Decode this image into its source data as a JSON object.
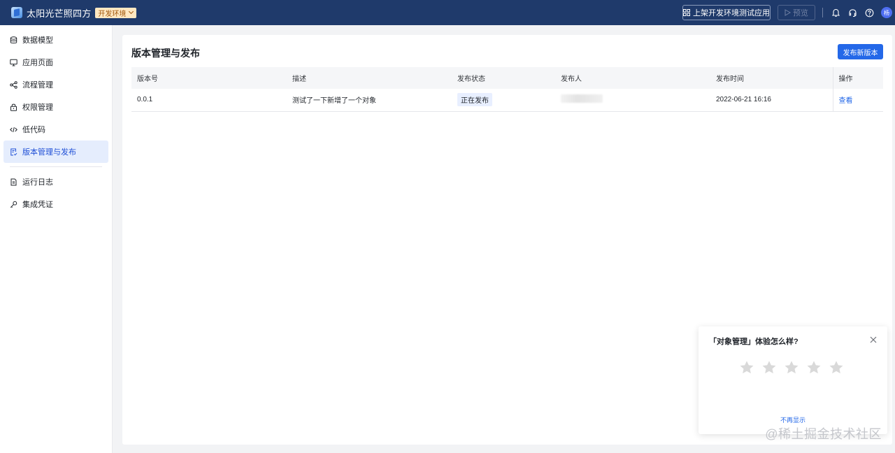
{
  "header": {
    "app_title": "太阳光芒照四方",
    "env_label": "开发环境",
    "publish_test_label": "上架开发环境测试应用",
    "preview_label": "预览",
    "avatar_text": "杨",
    "bg_color": "#1f3a6b"
  },
  "sidebar": {
    "items": [
      {
        "label": "数据模型",
        "icon": "database-icon"
      },
      {
        "label": "应用页面",
        "icon": "monitor-icon"
      },
      {
        "label": "流程管理",
        "icon": "flow-icon"
      },
      {
        "label": "权限管理",
        "icon": "lock-icon"
      },
      {
        "label": "低代码",
        "icon": "code-icon"
      },
      {
        "label": "版本管理与发布",
        "icon": "version-icon",
        "active": true
      }
    ],
    "bottom_items": [
      {
        "label": "运行日志",
        "icon": "document-icon"
      },
      {
        "label": "集成凭证",
        "icon": "key-icon"
      }
    ]
  },
  "main": {
    "title": "版本管理与发布",
    "new_version_button": "发布新版本",
    "table": {
      "columns": [
        "版本号",
        "描述",
        "发布状态",
        "发布人",
        "发布时间",
        "操作"
      ],
      "rows": [
        {
          "version": "0.0.1",
          "description": "测试了一下新增了一个对象",
          "status": "正在发布",
          "publisher": "",
          "time": "2022-06-21 16:16",
          "action": "查看"
        }
      ]
    }
  },
  "survey": {
    "title": "「对象管理」体验怎么样?",
    "star_count": 5,
    "dont_show_label": "不再显示"
  },
  "watermark": "@稀土掘金技术社区",
  "colors": {
    "accent": "#2468e8",
    "active_nav_bg": "#e5edfd",
    "star": "#d9d9d9"
  }
}
